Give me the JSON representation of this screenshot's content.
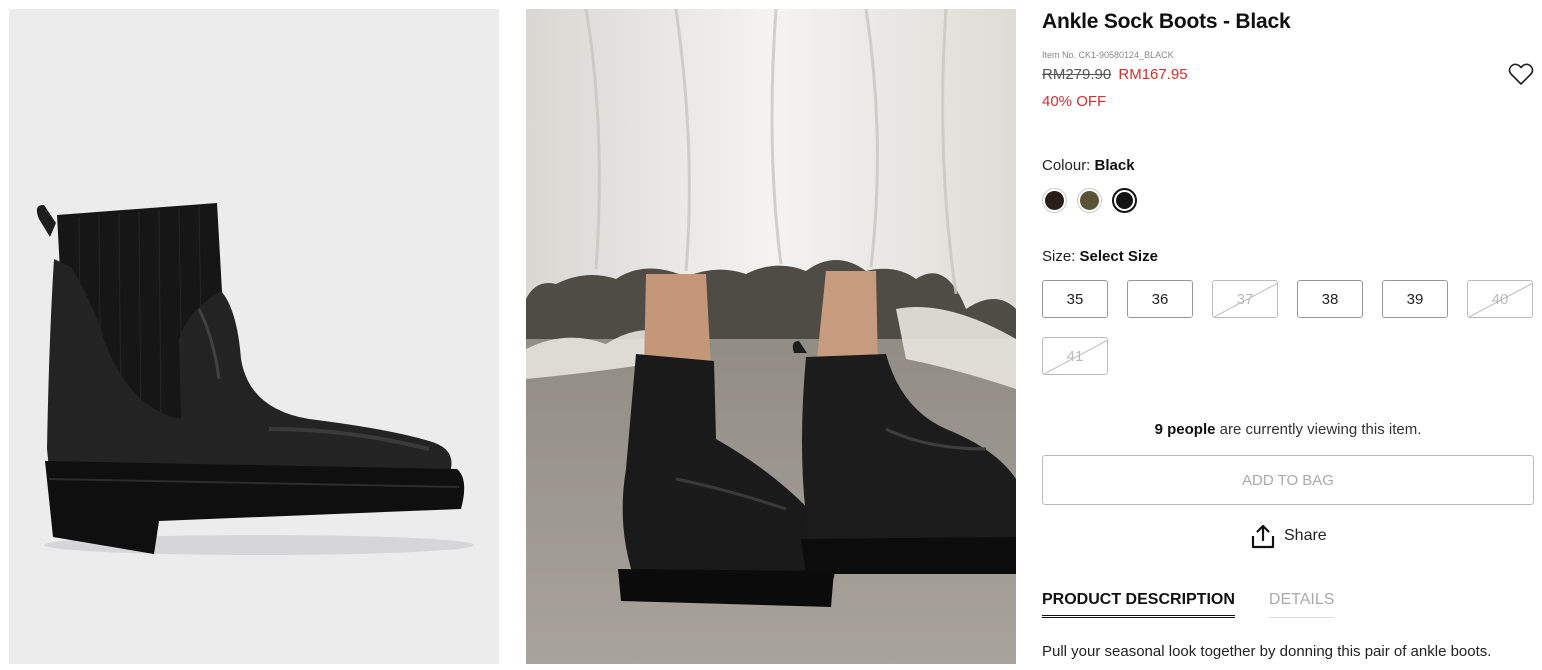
{
  "product": {
    "title": "Ankle Sock Boots - Black",
    "item_no": "Item No. CK1-90580124_BLACK",
    "price_original": "RM279.90",
    "price_sale": "RM167.95",
    "discount": "40% OFF"
  },
  "colour": {
    "label": "Colour:",
    "selected": "Black",
    "swatches": [
      {
        "name": "dark-brown",
        "hex": "#2a1c19",
        "selected": false
      },
      {
        "name": "olive",
        "hex": "#5a5236",
        "selected": false
      },
      {
        "name": "black",
        "hex": "#141414",
        "selected": true
      }
    ]
  },
  "size": {
    "label": "Size:",
    "selected": "Select Size",
    "options": [
      {
        "label": "35",
        "available": true
      },
      {
        "label": "36",
        "available": true
      },
      {
        "label": "37",
        "available": false
      },
      {
        "label": "38",
        "available": true
      },
      {
        "label": "39",
        "available": true
      },
      {
        "label": "40",
        "available": false
      },
      {
        "label": "41",
        "available": false
      }
    ]
  },
  "viewers": {
    "count": "9 people",
    "text": " are currently viewing this item."
  },
  "actions": {
    "add_to_bag": "ADD TO BAG",
    "share": "Share"
  },
  "tabs": [
    {
      "label": "PRODUCT DESCRIPTION",
      "active": true
    },
    {
      "label": "DETAILS",
      "active": false
    }
  ],
  "description": "Pull your seasonal look together by donning this pair of ankle boots.",
  "colors": {
    "sale": "#d42e2e",
    "text": "#111111",
    "muted": "#aaaaaa"
  },
  "icons": {
    "wishlist": "heart-outline-icon",
    "share": "share-upload-icon"
  }
}
